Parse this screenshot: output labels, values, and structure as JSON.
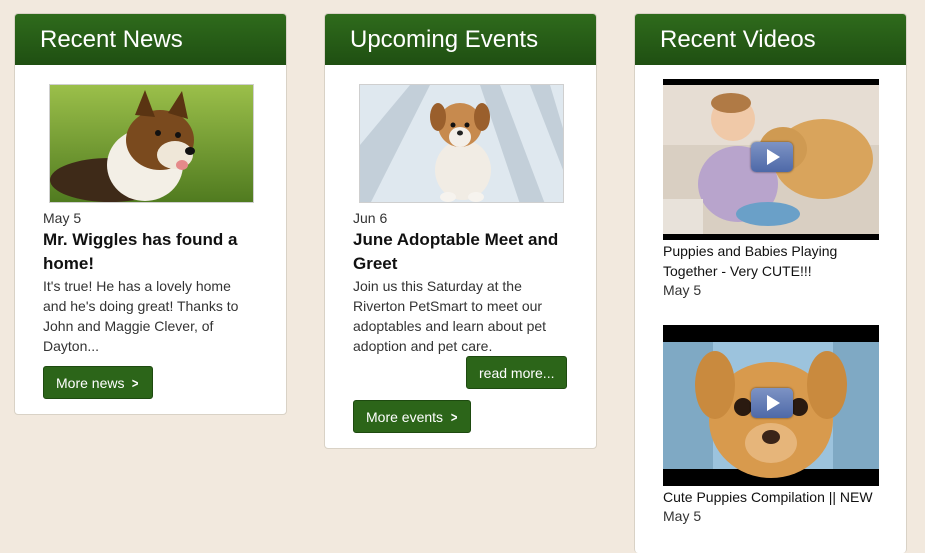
{
  "news": {
    "header": "Recent News",
    "date": "May 5",
    "title": "Mr. Wiggles has found a home!",
    "body": "It's true! He has a lovely home and he's doing great! Thanks to John and Maggie Clever, of Dayton...",
    "more_button": "More news"
  },
  "events": {
    "header": "Upcoming Events",
    "date": "Jun 6",
    "title": "June Adoptable Meet and Greet",
    "body": "Join us this Saturday at the Riverton PetSmart to meet our adoptables and learn about pet adoption and pet care.",
    "read_more_button": "read more...",
    "more_button": "More events"
  },
  "videos": {
    "header": "Recent Videos",
    "items": [
      {
        "caption": "Puppies and Babies Playing Together - Very CUTE!!!",
        "date": "May 5"
      },
      {
        "caption": "Cute Puppies Compilation || NEW",
        "date": "May 5"
      }
    ]
  },
  "icons": {
    "chevron": "chevron-right-icon",
    "play": "play-icon"
  },
  "colors": {
    "header_green": "#2f6b1c",
    "button_green": "#2c6519",
    "page_bg": "#f2e9de"
  }
}
